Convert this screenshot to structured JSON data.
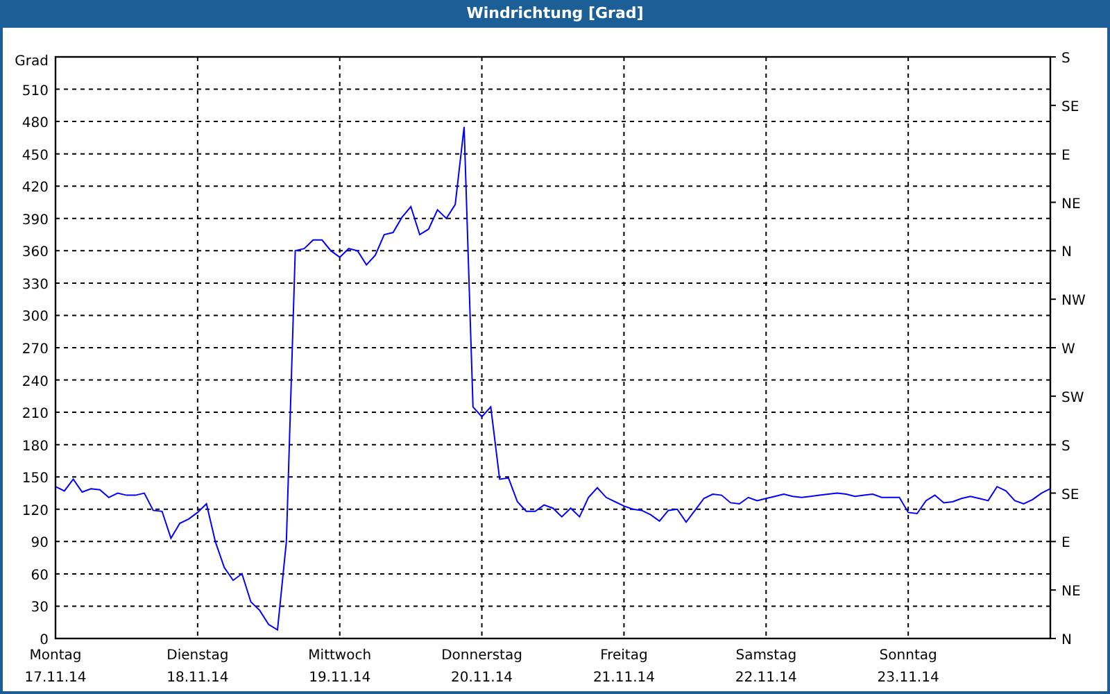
{
  "window": {
    "title": "Windrichtung [Grad]"
  },
  "chart": {
    "right_axis": {
      "labels": [
        "S",
        "SE",
        "E",
        "NE",
        "N",
        "NW",
        "W",
        "SW",
        "S",
        "SE",
        "E",
        "NE",
        "N"
      ]
    },
    "chart_data": {
      "type": "line",
      "grid": true,
      "ylabel": "Grad",
      "ylim": [
        0,
        540
      ],
      "yticks": [
        0,
        30,
        60,
        90,
        120,
        150,
        180,
        210,
        240,
        270,
        300,
        330,
        360,
        390,
        420,
        450,
        480,
        510
      ],
      "categories": [
        "Montag 17.11.14",
        null,
        null,
        null,
        null,
        null,
        null,
        null,
        null,
        null,
        null,
        null,
        null,
        null,
        null,
        null,
        "Dienstag 18.11.14",
        null,
        null,
        null,
        null,
        null,
        null,
        null,
        null,
        null,
        null,
        null,
        null,
        null,
        null,
        null,
        "Mittwoch 19.11.14",
        null,
        null,
        null,
        null,
        null,
        null,
        null,
        null,
        null,
        null,
        null,
        null,
        null,
        null,
        null,
        "Donnerstag 20.11.14",
        null,
        null,
        null,
        null,
        null,
        null,
        null,
        null,
        null,
        null,
        null,
        null,
        null,
        null,
        null,
        "Freitag 21.11.14",
        null,
        null,
        null,
        null,
        null,
        null,
        null,
        null,
        null,
        null,
        null,
        null,
        null,
        null,
        null,
        "Samstag 22.11.14",
        null,
        null,
        null,
        null,
        null,
        null,
        null,
        null,
        null,
        null,
        null,
        null,
        null,
        null,
        null,
        "Sonntag 23.11.14",
        null,
        null,
        null,
        null,
        null,
        null,
        null,
        null,
        null,
        null,
        null,
        null,
        null,
        null,
        null,
        null
      ],
      "series": [
        {
          "color": "#0000ff",
          "values": [
            141,
            137,
            148,
            136,
            139,
            138,
            131,
            135,
            133,
            133,
            135,
            119,
            118,
            93,
            107,
            111,
            117,
            125,
            90,
            66,
            54,
            60,
            34,
            26,
            13,
            8,
            90,
            360,
            362,
            370,
            370,
            360,
            354,
            362,
            360,
            347,
            356,
            375,
            377,
            391,
            401,
            375,
            380,
            398,
            390,
            403,
            475,
            215,
            206,
            215,
            148,
            149,
            127,
            118,
            118,
            124,
            121,
            113,
            121,
            113,
            131,
            140,
            131,
            127,
            123,
            120,
            119,
            115,
            109,
            119,
            120,
            108,
            119,
            130,
            134,
            133,
            126,
            125,
            131,
            128,
            130,
            132,
            134,
            132,
            131,
            132,
            133,
            134,
            135,
            134,
            132,
            133,
            134,
            131,
            131,
            131,
            117,
            116,
            128,
            133,
            126,
            127,
            130,
            132,
            130,
            128,
            141,
            137,
            128,
            125,
            129,
            135,
            139
          ]
        }
      ]
    }
  }
}
